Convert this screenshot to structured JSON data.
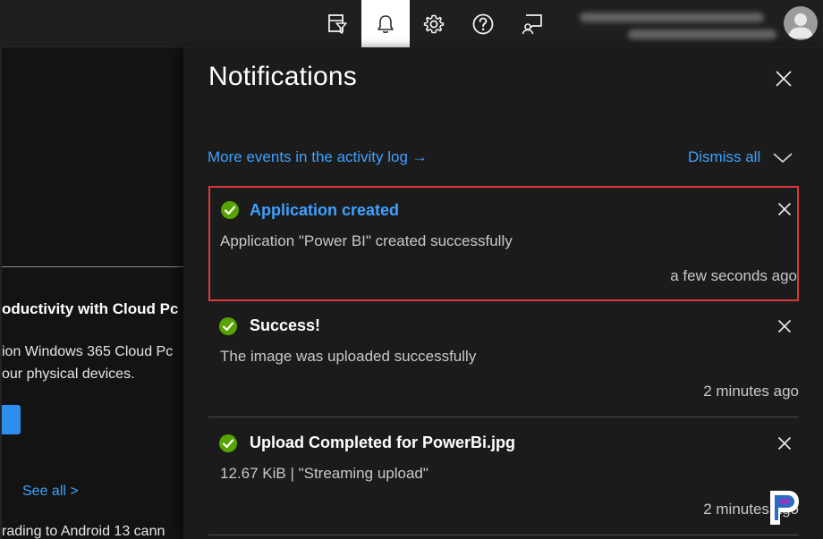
{
  "topbar": {
    "icons": [
      "directory-filter-icon",
      "bell-icon",
      "gear-icon",
      "help-icon",
      "feedback-icon"
    ],
    "active_icon": "bell-icon"
  },
  "background_page": {
    "heading": "oductivity with Cloud Pc",
    "line1": "ion Windows 365 Cloud Pc",
    "line2": "our physical devices.",
    "see_all": "See all >",
    "bottom_line": "rading to Android 13 cann"
  },
  "panel": {
    "title": "Notifications",
    "activity_link": "More events in the activity log →",
    "dismiss_all": "Dismiss all",
    "notifications": [
      {
        "title": "Application created",
        "description": "Application \"Power BI\" created successfully",
        "time": "a few seconds ago",
        "status": "success",
        "highlighted": true
      },
      {
        "title": "Success!",
        "description": "The image was uploaded successfully",
        "time": "2 minutes ago",
        "status": "success",
        "highlighted": false
      },
      {
        "title": "Upload Completed for PowerBi.jpg",
        "description": "12.67 KiB | \"Streaming upload\"",
        "time": "2 minutes ago",
        "status": "success",
        "highlighted": false
      }
    ]
  },
  "colors": {
    "link": "#3ea2ff",
    "success": "#57a300",
    "highlight_border": "#d9383c",
    "panel_bg": "#1b1b1b"
  }
}
